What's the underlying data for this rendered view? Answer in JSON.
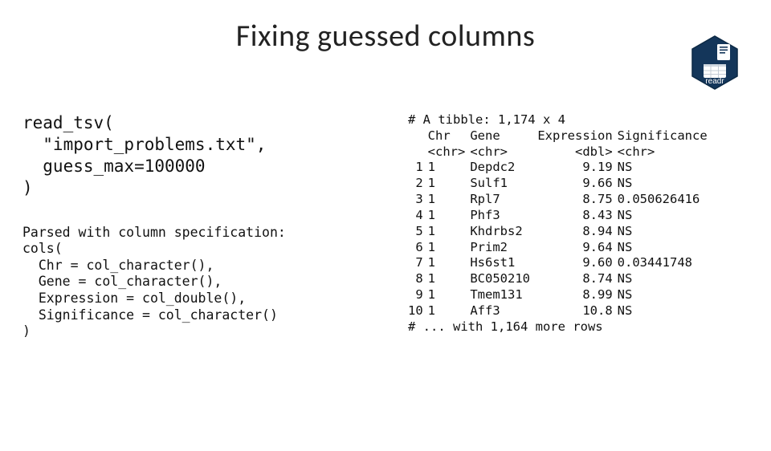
{
  "title": "Fixing guessed columns",
  "logo_label": "readr",
  "code": "read_tsv(\n  \"import_problems.txt\",\n  guess_max=100000\n)",
  "spec": "Parsed with column specification:\ncols(\n  Chr = col_character(),\n  Gene = col_character(),\n  Expression = col_double(),\n  Significance = col_character()\n)",
  "tibble_header": "# A tibble: 1,174 x 4",
  "columns": {
    "headers": [
      "Chr",
      "Gene",
      "Expression",
      "Significance"
    ],
    "types": [
      "<chr>",
      "<chr>",
      "<dbl>",
      "<chr>"
    ]
  },
  "rows": [
    {
      "i": " 1",
      "chr": "1",
      "gene": "Depdc2",
      "expr": " 9.19",
      "sig": "NS"
    },
    {
      "i": " 2",
      "chr": "1",
      "gene": "Sulf1",
      "expr": " 9.66",
      "sig": "NS"
    },
    {
      "i": " 3",
      "chr": "1",
      "gene": "Rpl7",
      "expr": " 8.75",
      "sig": "0.050626416"
    },
    {
      "i": " 4",
      "chr": "1",
      "gene": "Phf3",
      "expr": " 8.43",
      "sig": "NS"
    },
    {
      "i": " 5",
      "chr": "1",
      "gene": "Khdrbs2",
      "expr": " 8.94",
      "sig": "NS"
    },
    {
      "i": " 6",
      "chr": "1",
      "gene": "Prim2",
      "expr": " 9.64",
      "sig": "NS"
    },
    {
      "i": " 7",
      "chr": "1",
      "gene": "Hs6st1",
      "expr": " 9.60",
      "sig": "0.03441748"
    },
    {
      "i": " 8",
      "chr": "1",
      "gene": "BC050210",
      "expr": " 8.74",
      "sig": "NS"
    },
    {
      "i": " 9",
      "chr": "1",
      "gene": "Tmem131",
      "expr": " 8.99",
      "sig": "NS"
    },
    {
      "i": "10",
      "chr": "1",
      "gene": "Aff3",
      "expr": "10.8 ",
      "sig": "NS"
    }
  ],
  "tibble_footer": "# ... with 1,164 more rows"
}
